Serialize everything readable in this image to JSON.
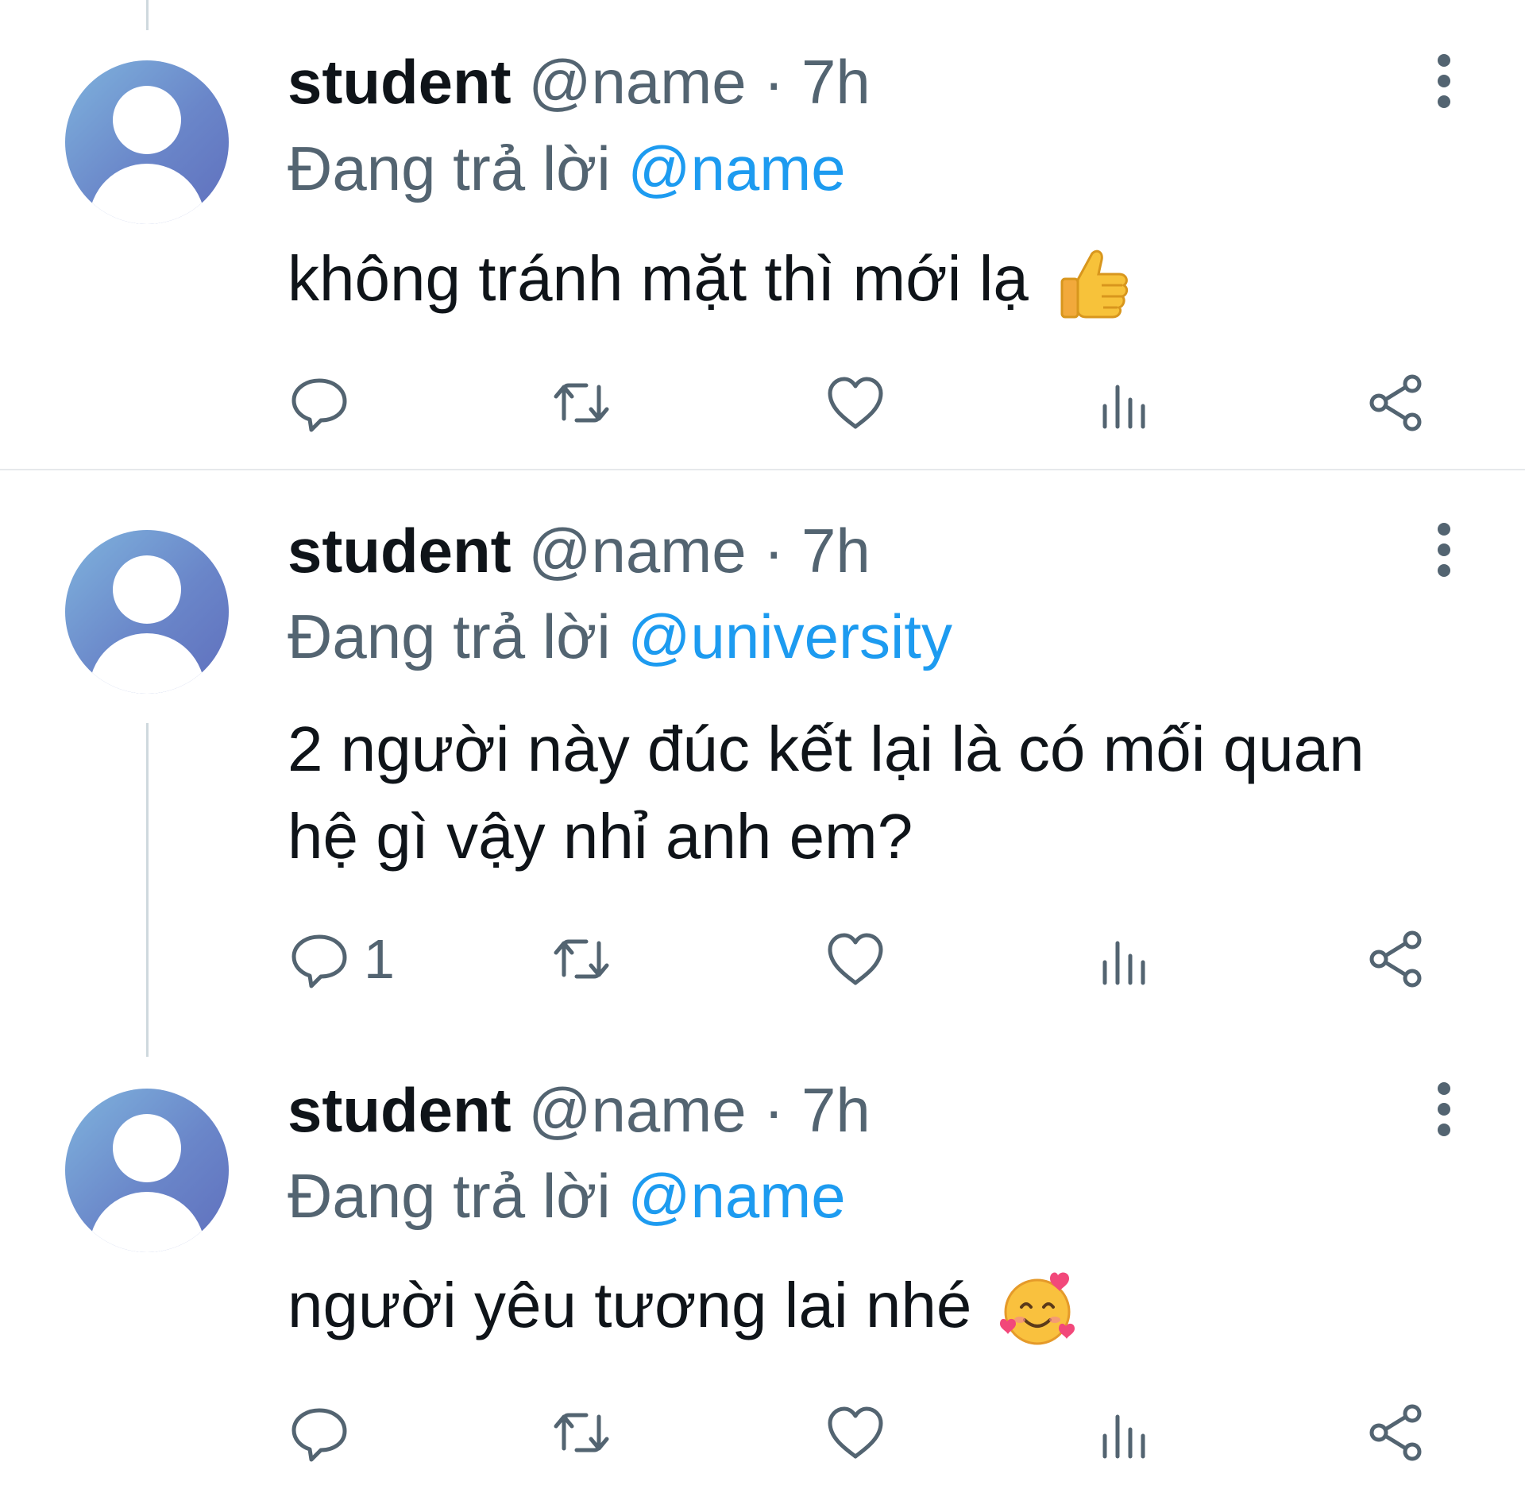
{
  "tweets": [
    {
      "display_name": "student",
      "handle": "@name",
      "separator": "·",
      "time": "7h",
      "reply_prefix": "Đang trả lời",
      "reply_mention": "@name",
      "text": "không tránh mặt thì mới lạ",
      "emoji": "thumbs-up",
      "reply_count": ""
    },
    {
      "display_name": "student",
      "handle": "@name",
      "separator": "·",
      "time": "7h",
      "reply_prefix": "Đang trả lời",
      "reply_mention": "@university",
      "text": "2 người này đúc kết lại là có mối quan hệ gì vậy nhỉ anh em?",
      "emoji": "",
      "reply_count": "1"
    },
    {
      "display_name": "student",
      "handle": "@name",
      "separator": "·",
      "time": "7h",
      "reply_prefix": "Đang trả lời",
      "reply_mention": "@name",
      "text": "người yêu tương lai nhé",
      "emoji": "smiling-face-with-hearts",
      "reply_count": ""
    }
  ],
  "colors": {
    "text": "#0f1419",
    "secondary": "#536471",
    "mention": "#1d9bf0"
  },
  "icons": [
    "reply-icon",
    "retweet-icon",
    "like-icon",
    "views-icon",
    "share-icon",
    "more-icon"
  ]
}
